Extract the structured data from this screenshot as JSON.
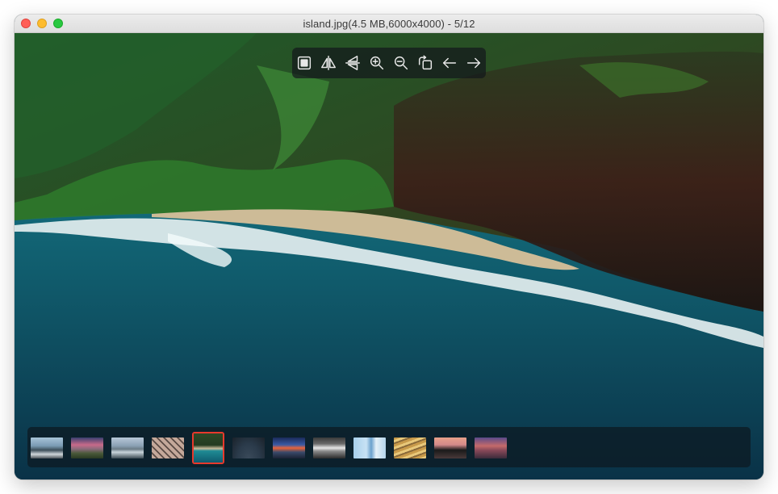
{
  "window": {
    "title": "island.jpg(4.5 MB,6000x4000) - 5/12"
  },
  "toolbar": {
    "buttons": [
      {
        "name": "fit-to-window",
        "icon": "stop-square-icon"
      },
      {
        "name": "flip-horizontal",
        "icon": "flip-horizontal-icon"
      },
      {
        "name": "flip-vertical",
        "icon": "flip-vertical-icon"
      },
      {
        "name": "zoom-in",
        "icon": "zoom-in-icon"
      },
      {
        "name": "zoom-out",
        "icon": "zoom-out-icon"
      },
      {
        "name": "rotate",
        "icon": "rotate-icon"
      },
      {
        "name": "previous",
        "icon": "arrow-left-icon"
      },
      {
        "name": "next",
        "icon": "arrow-right-icon"
      }
    ]
  },
  "thumbnails": {
    "count": 12,
    "selected_index": 4,
    "selection_color": "#e8392c"
  }
}
